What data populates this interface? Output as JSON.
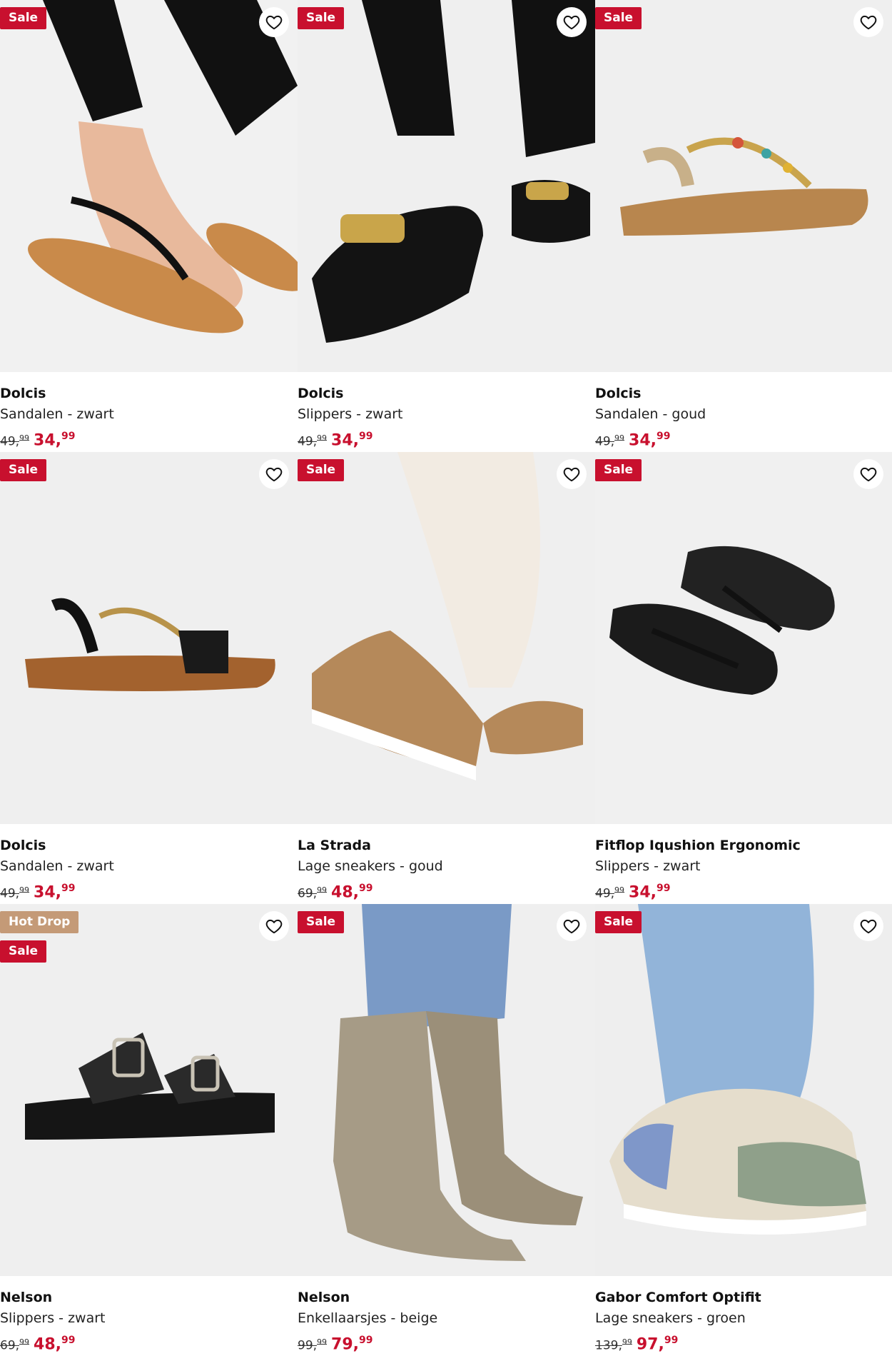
{
  "products": [
    {
      "brand": "Dolcis",
      "desc": "Sandalen - zwart",
      "old_int": "49,",
      "old_dec": "99",
      "new_int": "34,",
      "new_dec": "99",
      "badges": [
        "Sale"
      ],
      "image": "black-sandal-on-foot"
    },
    {
      "brand": "Dolcis",
      "desc": "Slippers - zwart",
      "old_int": "49,",
      "old_dec": "99",
      "new_int": "34,",
      "new_dec": "99",
      "badges": [
        "Sale"
      ],
      "image": "black-chain-slipper-on-foot"
    },
    {
      "brand": "Dolcis",
      "desc": "Sandalen - goud",
      "old_int": "49,",
      "old_dec": "99",
      "new_int": "34,",
      "new_dec": "99",
      "badges": [
        "Sale"
      ],
      "image": "gold-jeweled-sandal"
    },
    {
      "brand": "Dolcis",
      "desc": "Sandalen - zwart",
      "old_int": "49,",
      "old_dec": "99",
      "new_int": "34,",
      "new_dec": "99",
      "badges": [
        "Sale"
      ],
      "image": "black-woven-sandal"
    },
    {
      "brand": "La Strada",
      "desc": "Lage sneakers - goud",
      "old_int": "69,",
      "old_dec": "99",
      "new_int": "48,",
      "new_dec": "99",
      "badges": [
        "Sale"
      ],
      "image": "gold-knit-sneaker-on-foot"
    },
    {
      "brand": "Fitflop Iqushion Ergonomic",
      "desc": "Slippers - zwart",
      "old_int": "49,",
      "old_dec": "99",
      "new_int": "34,",
      "new_dec": "99",
      "badges": [
        "Sale"
      ],
      "image": "black-flip-flops"
    },
    {
      "brand": "Nelson",
      "desc": "Slippers - zwart",
      "old_int": "69,",
      "old_dec": "99",
      "new_int": "48,",
      "new_dec": "99",
      "badges": [
        "Hot Drop",
        "Sale"
      ],
      "image": "black-buckle-slide"
    },
    {
      "brand": "Nelson",
      "desc": "Enkellaarsjes - beige",
      "old_int": "99,",
      "old_dec": "99",
      "new_int": "79,",
      "new_dec": "99",
      "badges": [
        "Sale"
      ],
      "image": "beige-western-boots"
    },
    {
      "brand": "Gabor Comfort Optifit",
      "desc": "Lage sneakers - groen",
      "old_int": "139,",
      "old_dec": "99",
      "new_int": "97,",
      "new_dec": "99",
      "badges": [
        "Sale"
      ],
      "image": "green-sneaker-on-foot"
    }
  ],
  "colors": {
    "sale": "#c8102e",
    "hot_drop": "#c49a77",
    "price": "#c8102e"
  },
  "icons": {
    "wishlist": "heart-outline-icon"
  }
}
